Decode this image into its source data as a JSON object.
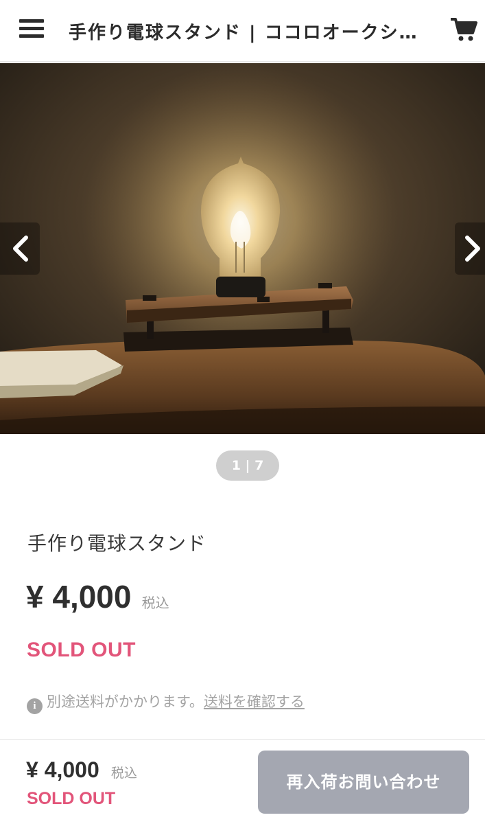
{
  "header": {
    "title": "手作り電球スタンド | ココロオークシ…",
    "menu_icon": "hamburger-menu-icon",
    "cart_icon": "shopping-cart-icon"
  },
  "gallery": {
    "counter": "1 | 7",
    "prev_icon": "chevron-left-icon",
    "next_icon": "chevron-right-icon"
  },
  "product": {
    "name": "手作り電球スタンド",
    "price": "¥ 4,000",
    "tax_label": "税込",
    "status": "SOLD OUT",
    "shipping_note": "別途送料がかかります。",
    "shipping_link": "送料を確認する",
    "info_icon": "info-icon"
  },
  "bottom_bar": {
    "price": "¥ 4,000",
    "tax_label": "税込",
    "status": "SOLD OUT",
    "restock_button": "再入荷お問い合わせ"
  },
  "colors": {
    "sold_out": "#e2557a",
    "button_bg": "#a4a7b1",
    "counter_bg": "#cfcfcf"
  }
}
